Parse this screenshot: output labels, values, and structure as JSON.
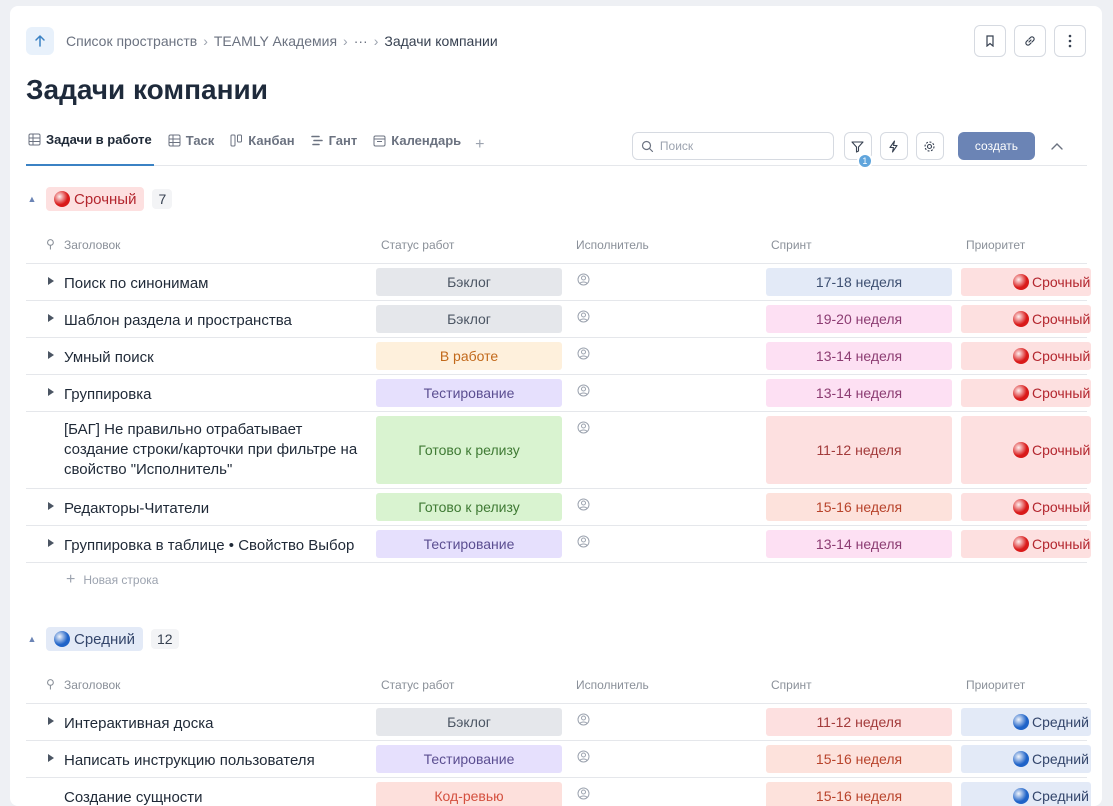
{
  "breadcrumbs": [
    "Список пространств",
    "TEAMLY Академия",
    "···",
    "Задачи компании"
  ],
  "page_title": "Задачи компании",
  "tabs": [
    {
      "label": "Задачи в работе",
      "icon": "table-icon",
      "active": true
    },
    {
      "label": "Таск",
      "icon": "table-icon",
      "active": false
    },
    {
      "label": "Канбан",
      "icon": "kanban-icon",
      "active": false
    },
    {
      "label": "Гант",
      "icon": "gantt-icon",
      "active": false
    },
    {
      "label": "Календарь",
      "icon": "calendar-icon",
      "active": false
    }
  ],
  "search": {
    "placeholder": "Поиск",
    "value": ""
  },
  "filter_badge": "1",
  "create_label": "создать",
  "columns": [
    "Заголовок",
    "Статус работ",
    "Исполнитель",
    "Спринт",
    "Приоритет"
  ],
  "new_row_label": "Новая строка",
  "status_colors": {
    "Бэклог": {
      "bg": "#e5e7eb",
      "fg": "#4b5563"
    },
    "В работе": {
      "bg": "#fef0dc",
      "fg": "#c2691b"
    },
    "Тестирование": {
      "bg": "#e6e0fd",
      "fg": "#5b4e91"
    },
    "Готово к релизу": {
      "bg": "#d9f3d0",
      "fg": "#3f7a34"
    },
    "Код-ревью": {
      "bg": "#fde0dc",
      "fg": "#d4503f"
    }
  },
  "sprint_colors": {
    "17-18 неделя": {
      "bg": "#e3eaf7",
      "fg": "#3d4f71"
    },
    "19-20 неделя": {
      "bg": "#fde0f3",
      "fg": "#8c3c72"
    },
    "13-14 неделя": {
      "bg": "#fde0f3",
      "fg": "#8c3c72"
    },
    "11-12 неделя": {
      "bg": "#fde0e0",
      "fg": "#a23a3a"
    },
    "15-16 неделя": {
      "bg": "#fde2dc",
      "fg": "#b8432b"
    }
  },
  "groups": [
    {
      "label": "Срочный",
      "dot_color": "#d91a1a",
      "pill_bg": "#fde0e0",
      "pill_fg": "#b3262e",
      "count": "7",
      "rows": [
        {
          "title": "Поиск по синонимам",
          "status": "Бэклог",
          "sprint": "17-18 неделя",
          "priority": "Срочный",
          "expandable": true,
          "tall": false
        },
        {
          "title": "Шаблон раздела и пространства",
          "status": "Бэклог",
          "sprint": "19-20 неделя",
          "priority": "Срочный",
          "expandable": true,
          "tall": false
        },
        {
          "title": "Умный поиск",
          "status": "В работе",
          "sprint": "13-14 неделя",
          "priority": "Срочный",
          "expandable": true,
          "tall": false
        },
        {
          "title": "Группировка",
          "status": "Тестирование",
          "sprint": "13-14 неделя",
          "priority": "Срочный",
          "expandable": true,
          "tall": false
        },
        {
          "title": "[БАГ] Не правильно отрабатывает создание строки/карточки при фильтре на свойство \"Исполнитель\"",
          "status": "Готово к релизу",
          "sprint": "11-12 неделя",
          "priority": "Срочный",
          "expandable": false,
          "tall": true
        },
        {
          "title": "Редакторы-Читатели",
          "status": "Готово к релизу",
          "sprint": "15-16 неделя",
          "priority": "Срочный",
          "expandable": true,
          "tall": false
        },
        {
          "title": "Группировка в таблице • Свойство Выбор",
          "status": "Тестирование",
          "sprint": "13-14 неделя",
          "priority": "Срочный",
          "expandable": true,
          "tall": false
        }
      ]
    },
    {
      "label": "Средний",
      "dot_color": "#1f63c8",
      "pill_bg": "#e3eaf7",
      "pill_fg": "#33456b",
      "count": "12",
      "rows": [
        {
          "title": "Интерактивная доска",
          "status": "Бэклог",
          "sprint": "11-12 неделя",
          "priority": "Средний",
          "expandable": true,
          "tall": false
        },
        {
          "title": "Написать инструкцию пользователя",
          "status": "Тестирование",
          "sprint": "15-16 неделя",
          "priority": "Средний",
          "expandable": true,
          "tall": false
        },
        {
          "title": "Создание сущности",
          "status": "Код-ревью",
          "sprint": "15-16 неделя",
          "priority": "Средний",
          "expandable": false,
          "tall": false
        }
      ]
    }
  ]
}
